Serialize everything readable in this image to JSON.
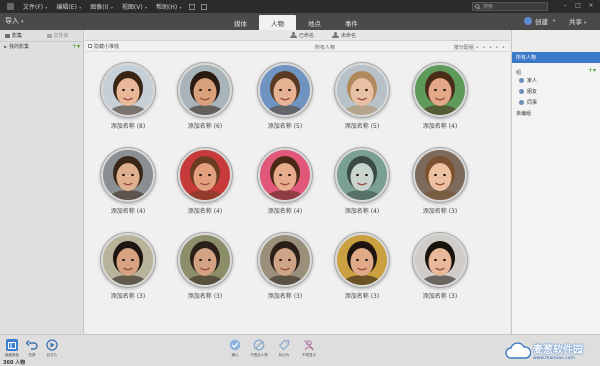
{
  "menubar": {
    "items": [
      "文件(F)",
      "编辑(E)",
      "图像(I)",
      "视图(V)",
      "帮助(H)"
    ],
    "search_placeholder": "搜索"
  },
  "toolbar": {
    "import": "导入",
    "tabs": [
      "媒体",
      "人物",
      "地点",
      "事件"
    ],
    "active_tab_index": 1,
    "create": "创建",
    "share": "共享"
  },
  "sidebar": {
    "tab_media": "影集",
    "tab_folders": "文件夹",
    "my_albums": "我的影集"
  },
  "subtabs": {
    "named": "已命名",
    "unnamed": "未命名"
  },
  "filterbar": {
    "hide_small_stacks": "隐藏小堆栈",
    "all_people": "所有人物",
    "sort": "按分配组"
  },
  "faces": [
    {
      "label": "添加名称 (8)",
      "skin": "#e8b898",
      "hair": "#3a2414",
      "bg": "#c5cfd8"
    },
    {
      "label": "添加名称 (6)",
      "skin": "#d9a07c",
      "hair": "#2a1a10",
      "bg": "#a8b3ba"
    },
    {
      "label": "添加名称 (5)",
      "skin": "#e5b294",
      "hair": "#5a3a22",
      "bg": "#6f94c2"
    },
    {
      "label": "添加名称 (5)",
      "skin": "#e8c0a4",
      "hair": "#b08a5c",
      "bg": "#b8c1c8"
    },
    {
      "label": "添加名称 (4)",
      "skin": "#e2a888",
      "hair": "#4a2c18",
      "bg": "#5e9a5a"
    },
    {
      "label": "添加名称 (4)",
      "skin": "#deb090",
      "hair": "#3a2616",
      "bg": "#8a8f92"
    },
    {
      "label": "添加名称 (4)",
      "skin": "#e2a07e",
      "hair": "#6a3c20",
      "bg": "#c63a3a"
    },
    {
      "label": "添加名称 (4)",
      "skin": "#e6ac8c",
      "hair": "#4a2a16",
      "bg": "#e0577a"
    },
    {
      "label": "添加名称 (4)",
      "skin": "#c8d4cc",
      "hair": "#3a4a44",
      "bg": "#7a9f94"
    },
    {
      "label": "添加名称 (3)",
      "skin": "#ecc0a0",
      "hair": "#7a5230",
      "bg": "#7d6a5a"
    },
    {
      "label": "添加名称 (3)",
      "skin": "#d8a282",
      "hair": "#1e1410",
      "bg": "#b7b29a"
    },
    {
      "label": "添加名称 (3)",
      "skin": "#d2a282",
      "hair": "#2a2018",
      "bg": "#8c8e6a"
    },
    {
      "label": "添加名称 (3)",
      "skin": "#cda486",
      "hair": "#2a2018",
      "bg": "#9a8f7a"
    },
    {
      "label": "添加名称 (3)",
      "skin": "#e0aa88",
      "hair": "#1e1410",
      "bg": "#caa040"
    },
    {
      "label": "添加名称 (3)",
      "skin": "#e8b89a",
      "hair": "#1a120c",
      "bg": "#d0cdc8"
    }
  ],
  "rpanel": {
    "title": "所有人物",
    "group_label": "组",
    "items": [
      "家人",
      "朋友",
      "同事"
    ],
    "ungrouped": "未编组"
  },
  "bottombar": {
    "buttons": [
      "隐藏面板",
      "还原",
      "幻灯片",
      "确认",
      "不是此人物",
      "标记为",
      "不再显示"
    ],
    "status": "360 人物"
  },
  "watermark": {
    "main": "麦葱软件园",
    "sub": "www.mairuan.com"
  },
  "colors": {
    "accent": "#3a78c8",
    "toolbar": "#4a4a4a",
    "menubar": "#2b2b2b"
  }
}
